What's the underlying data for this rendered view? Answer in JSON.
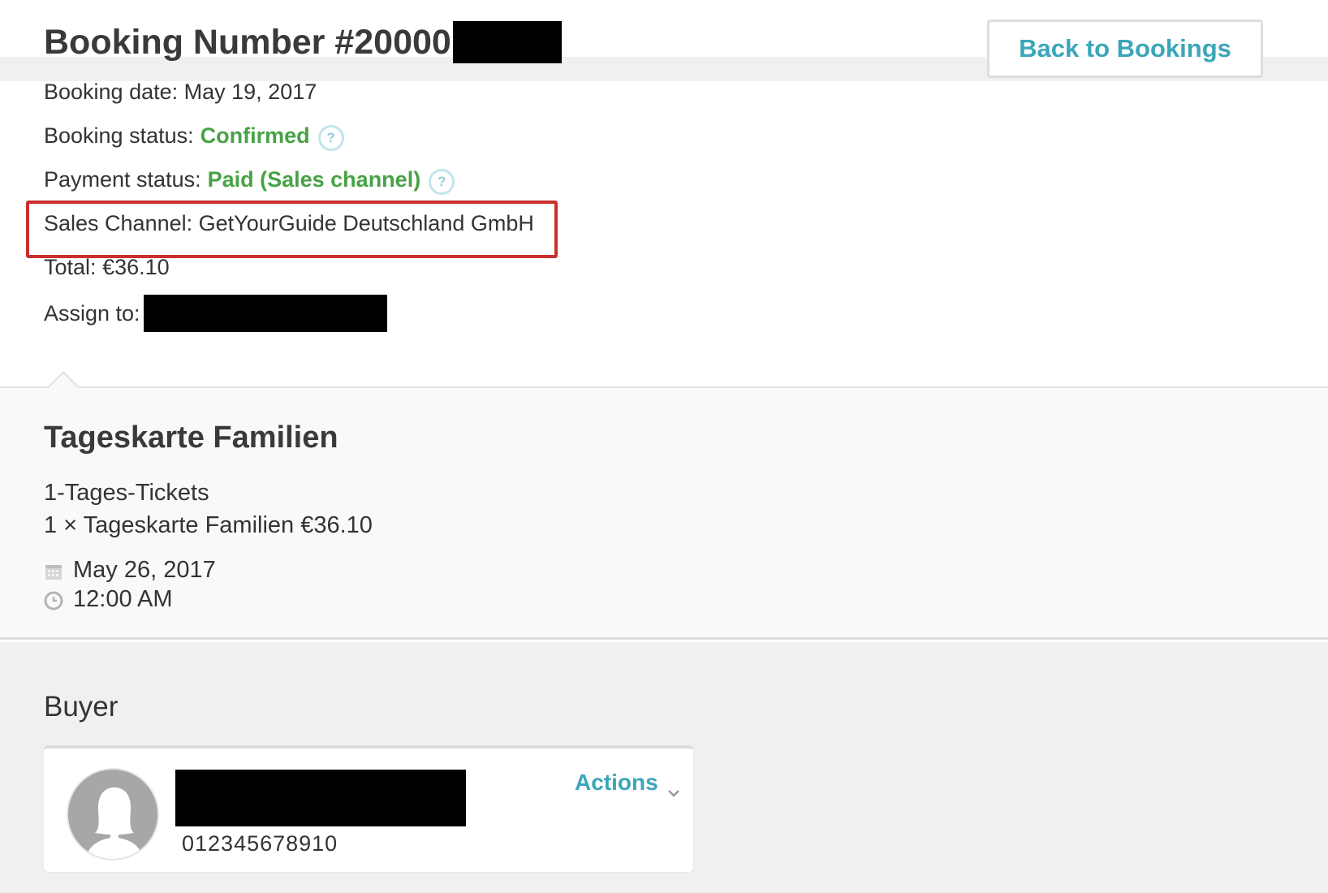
{
  "header": {
    "title_prefix": "Booking Number #20000",
    "back_button_label": "Back to Bookings"
  },
  "booking": {
    "date_label": "Booking date:",
    "date_value": "May 19, 2017",
    "status_label": "Booking status:",
    "status_value": "Confirmed",
    "payment_label": "Payment status:",
    "payment_value": "Paid (Sales channel)",
    "sales_channel_label": "Sales Channel:",
    "sales_channel_value": "GetYourGuide Deutschland GmbH",
    "total_label": "Total:",
    "total_value": "€36.10",
    "assign_label": "Assign to:",
    "help_icon_glyph": "?"
  },
  "product": {
    "title": "Tageskarte Familien",
    "ticket_type": "1-Tages-Tickets",
    "line_item": "1 × Tageskarte Familien €36.10",
    "date": "May 26, 2017",
    "time": "12:00 AM"
  },
  "buyer": {
    "heading": "Buyer",
    "phone": "012345678910",
    "actions_label": "Actions"
  },
  "colors": {
    "accent": "#3aa6b9",
    "status_green": "#47a245",
    "highlight_red": "#c9302c"
  },
  "icons": {
    "help": "help-circle-icon",
    "calendar": "calendar-icon",
    "clock": "clock-icon",
    "chevron": "chevron-down-icon",
    "avatar": "user-silhouette-icon"
  }
}
